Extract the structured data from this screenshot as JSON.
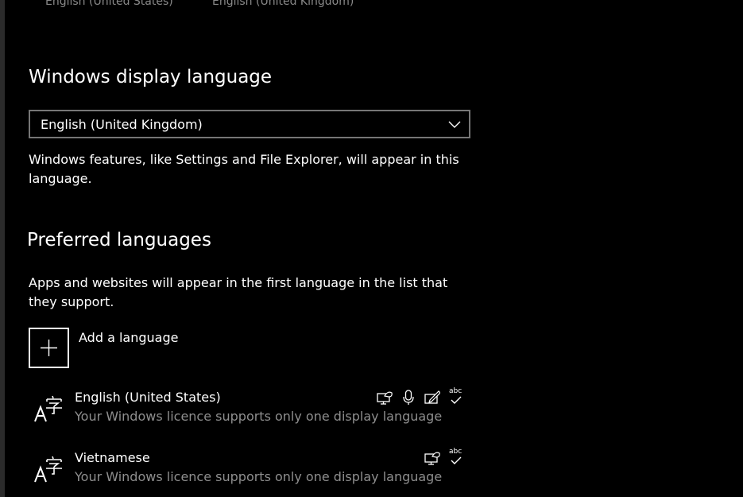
{
  "top_options": {
    "left": "English (United States)",
    "right": "English (United Kingdom)"
  },
  "display_language": {
    "heading": "Windows display language",
    "selected": "English (United Kingdom)",
    "description": "Windows features, like Settings and File Explorer, will appear in this language."
  },
  "preferred_languages": {
    "heading": "Preferred languages",
    "description": "Apps and websites will appear in the first language in the list that they support.",
    "add_label": "Add a language",
    "items": [
      {
        "name": "English (United States)",
        "note": "Your Windows licence supports only one display language",
        "features": [
          "display-language-icon",
          "speech-icon",
          "handwriting-icon",
          "spellcheck-icon"
        ]
      },
      {
        "name": "Vietnamese",
        "note": "Your Windows licence supports only one display language",
        "features": [
          "display-language-icon",
          "spellcheck-icon"
        ]
      }
    ]
  },
  "icon_text": {
    "spellcheck": "abc"
  },
  "colors": {
    "background": "#000000",
    "text": "#ffffff",
    "secondary_text": "#8e8e8e",
    "dropdown_border": "#767676"
  }
}
